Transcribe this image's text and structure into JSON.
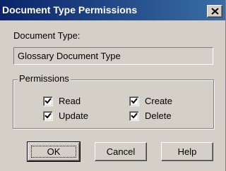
{
  "window": {
    "title": "Document Type Permissions",
    "close_icon": "close-icon"
  },
  "document_type": {
    "label": "Document Type:",
    "value": "Glossary Document Type"
  },
  "permissions": {
    "legend": "Permissions",
    "items": [
      {
        "label": "Read",
        "checked": true
      },
      {
        "label": "Create",
        "checked": true
      },
      {
        "label": "Update",
        "checked": true
      },
      {
        "label": "Delete",
        "checked": true
      }
    ]
  },
  "buttons": {
    "ok": "OK",
    "cancel": "Cancel",
    "help": "Help"
  },
  "colors": {
    "title_bar_start": "#0a246a",
    "title_bar_end": "#3a6ea5",
    "dialog_face": "#d4d0c8"
  }
}
